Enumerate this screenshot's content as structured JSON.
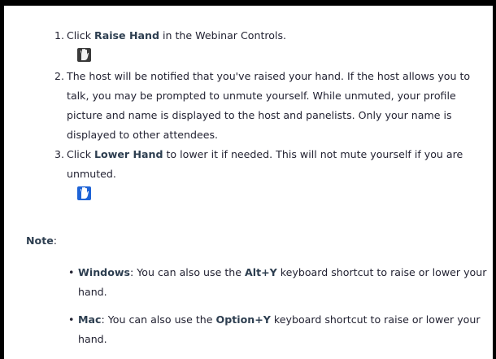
{
  "steps": [
    {
      "number": "1.",
      "pre": "Click ",
      "bold": "Raise Hand",
      "post": " in the Webinar Controls.",
      "icon": "raise-hand-icon"
    },
    {
      "number": "2.",
      "text": "The host will be notified that you've raised your hand. If the host allows you to talk, you may be prompted to unmute yourself. While unmuted, your profile picture and name is displayed to the host and panelists. Only your name is displayed to other attendees."
    },
    {
      "number": "3.",
      "pre": "Click ",
      "bold": "Lower Hand",
      "post": " to lower it if needed. This will not mute yourself if you are unmuted.",
      "icon": "lower-hand-icon"
    }
  ],
  "note": {
    "label": "Note",
    "suffix": ":"
  },
  "notes": [
    {
      "bullet": "•",
      "platform": "Windows",
      "pre": ": You can also use the ",
      "shortcut": "Alt+Y",
      "post": " keyboard shortcut to raise or lower your hand."
    },
    {
      "bullet": "•",
      "platform": "Mac",
      "pre": ": You can also use the ",
      "shortcut": "Option+Y",
      "post": " keyboard shortcut to raise or lower your hand."
    }
  ],
  "colors": {
    "text": "#232333",
    "bold": "#2D3E50",
    "raise_hand_icon_bg": "#3a3a3a",
    "lower_hand_icon_bg": "#1e63d6"
  }
}
